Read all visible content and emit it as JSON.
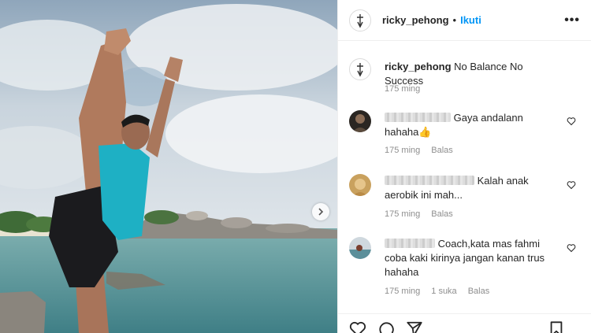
{
  "post": {
    "username": "ricky_pehong",
    "separator": "•",
    "follow_label": "Ikuti",
    "more_label": "•••",
    "caption_user": "ricky_pehong",
    "caption_text": "No Balance No Success",
    "caption_time": "175 ming"
  },
  "comments": [
    {
      "text": "Gaya andalann hahaha👍",
      "time": "175 ming",
      "likes": "",
      "reply_label": "Balas"
    },
    {
      "text": "Kalah anak aerobik ini mah...",
      "time": "175 ming",
      "likes": "",
      "reply_label": "Balas"
    },
    {
      "text": "Coach,kata mas fahmi coba kaki kirinya jangan kanan trus hahaha",
      "time": "175 ming",
      "likes": "1 suka",
      "reply_label": "Balas"
    }
  ],
  "icons": {
    "next": "chevron-right-icon",
    "like": "heart-icon",
    "comment": "comment-icon",
    "share": "send-icon",
    "save": "bookmark-icon"
  },
  "colors": {
    "accent": "#0095f6",
    "muted": "#8e8e8e",
    "text": "#262626"
  }
}
